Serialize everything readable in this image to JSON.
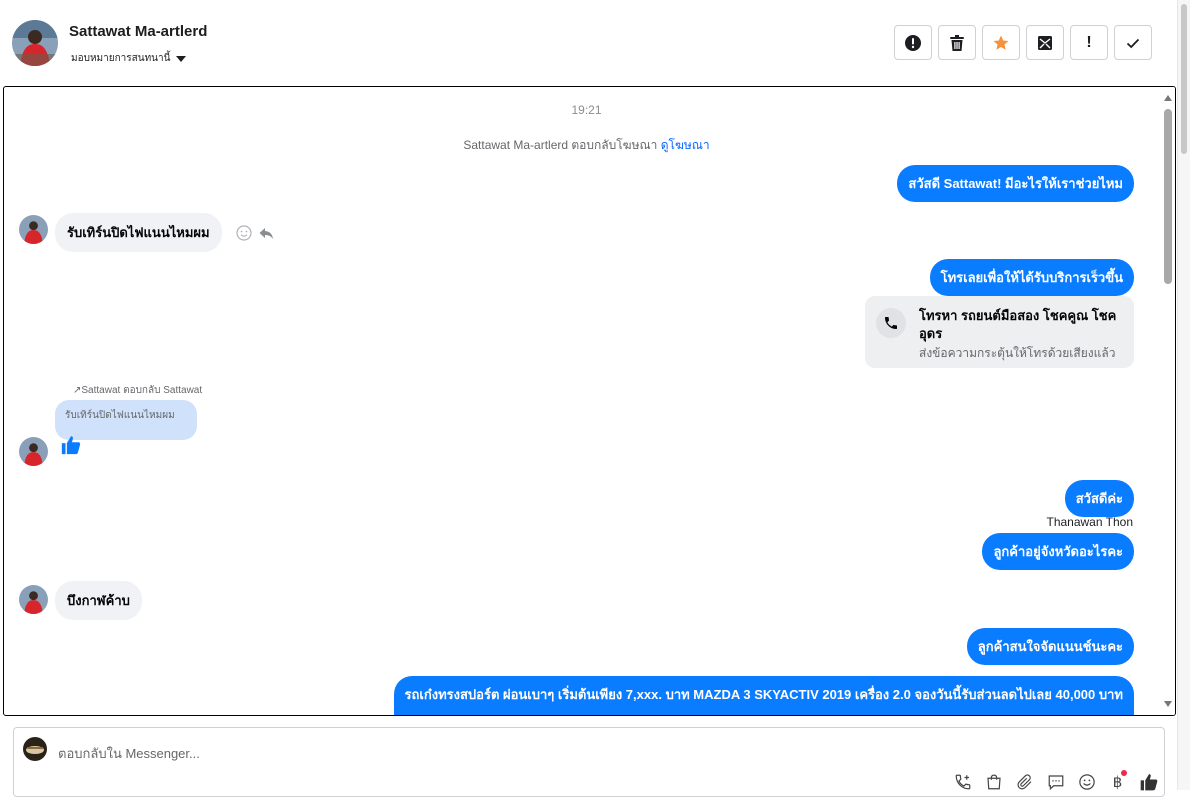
{
  "header": {
    "contact_name": "Sattawat Ma-artlerd",
    "assign_label": "มอบหมายการสนทนานี้",
    "toolbar": [
      {
        "name": "report-button",
        "icon": "alert-circle-icon"
      },
      {
        "name": "delete-button",
        "icon": "trash-icon"
      },
      {
        "name": "star-button",
        "icon": "star-icon",
        "color": "#f7923a"
      },
      {
        "name": "mark-unread-button",
        "icon": "envelope-icon"
      },
      {
        "name": "important-button",
        "label": "!"
      },
      {
        "name": "done-button",
        "icon": "check-icon"
      }
    ]
  },
  "conversation": {
    "timestamp": "19:21",
    "ad_reply_text": "Sattawat Ma-artlerd ตอบกลับโฆษณา",
    "ad_reply_link": "ดูโฆษณา",
    "messages": {
      "m1": "สวัสดี Sattawat! มีอะไรให้เราช่วยไหม",
      "m2": "รับเทิร์นปิดไฟแนนไหมผม",
      "m3": "โทรเลยเพื่อให้ได้รับบริการเร็วขึ้น",
      "call_title": "โทรหา รถยนต์มือสอง โชคคูณ โชค อุดร",
      "call_sub": "ส่งข้อความกระตุ้นให้โทรด้วยเสียงแล้ว",
      "reply_label": "Sattawat ตอบกลับ Sattawat",
      "quoted": "รับเทิร์นปิดไฟแนนไหมผม",
      "m5": "สวัสดีค่ะ",
      "sender": "Thanawan Thon",
      "m6": "ลูกค้าอยู่จังหวัดอะไรคะ",
      "m7": "บึงกาฬค้าบ",
      "m8": "ลูกค้าสนใจจัดแนนช์นะคะ",
      "m9": "รถเก๋งทรงสปอร์ต ผ่อนเบาๆ เริ่มต้นเพียง 7,xxx. บาท MAZDA 3 SKYACTIV 2019 เครื่อง 2.0 จองวันนี้รับส่วนลดไปเลย 40,000 บาท"
    }
  },
  "composer": {
    "placeholder": "ตอบกลับใน Messenger...",
    "tools": [
      "phone-plus-icon",
      "shopping-bag-icon",
      "paperclip-icon",
      "chat-bubble-icon",
      "emoji-icon",
      "baht-icon",
      "thumbs-up-icon"
    ],
    "baht_symbol": "฿"
  },
  "colors": {
    "outgoing_bubble": "#0a7cff",
    "incoming_bubble": "#f0f2f5",
    "link": "#0866ff",
    "star": "#f7923a"
  }
}
